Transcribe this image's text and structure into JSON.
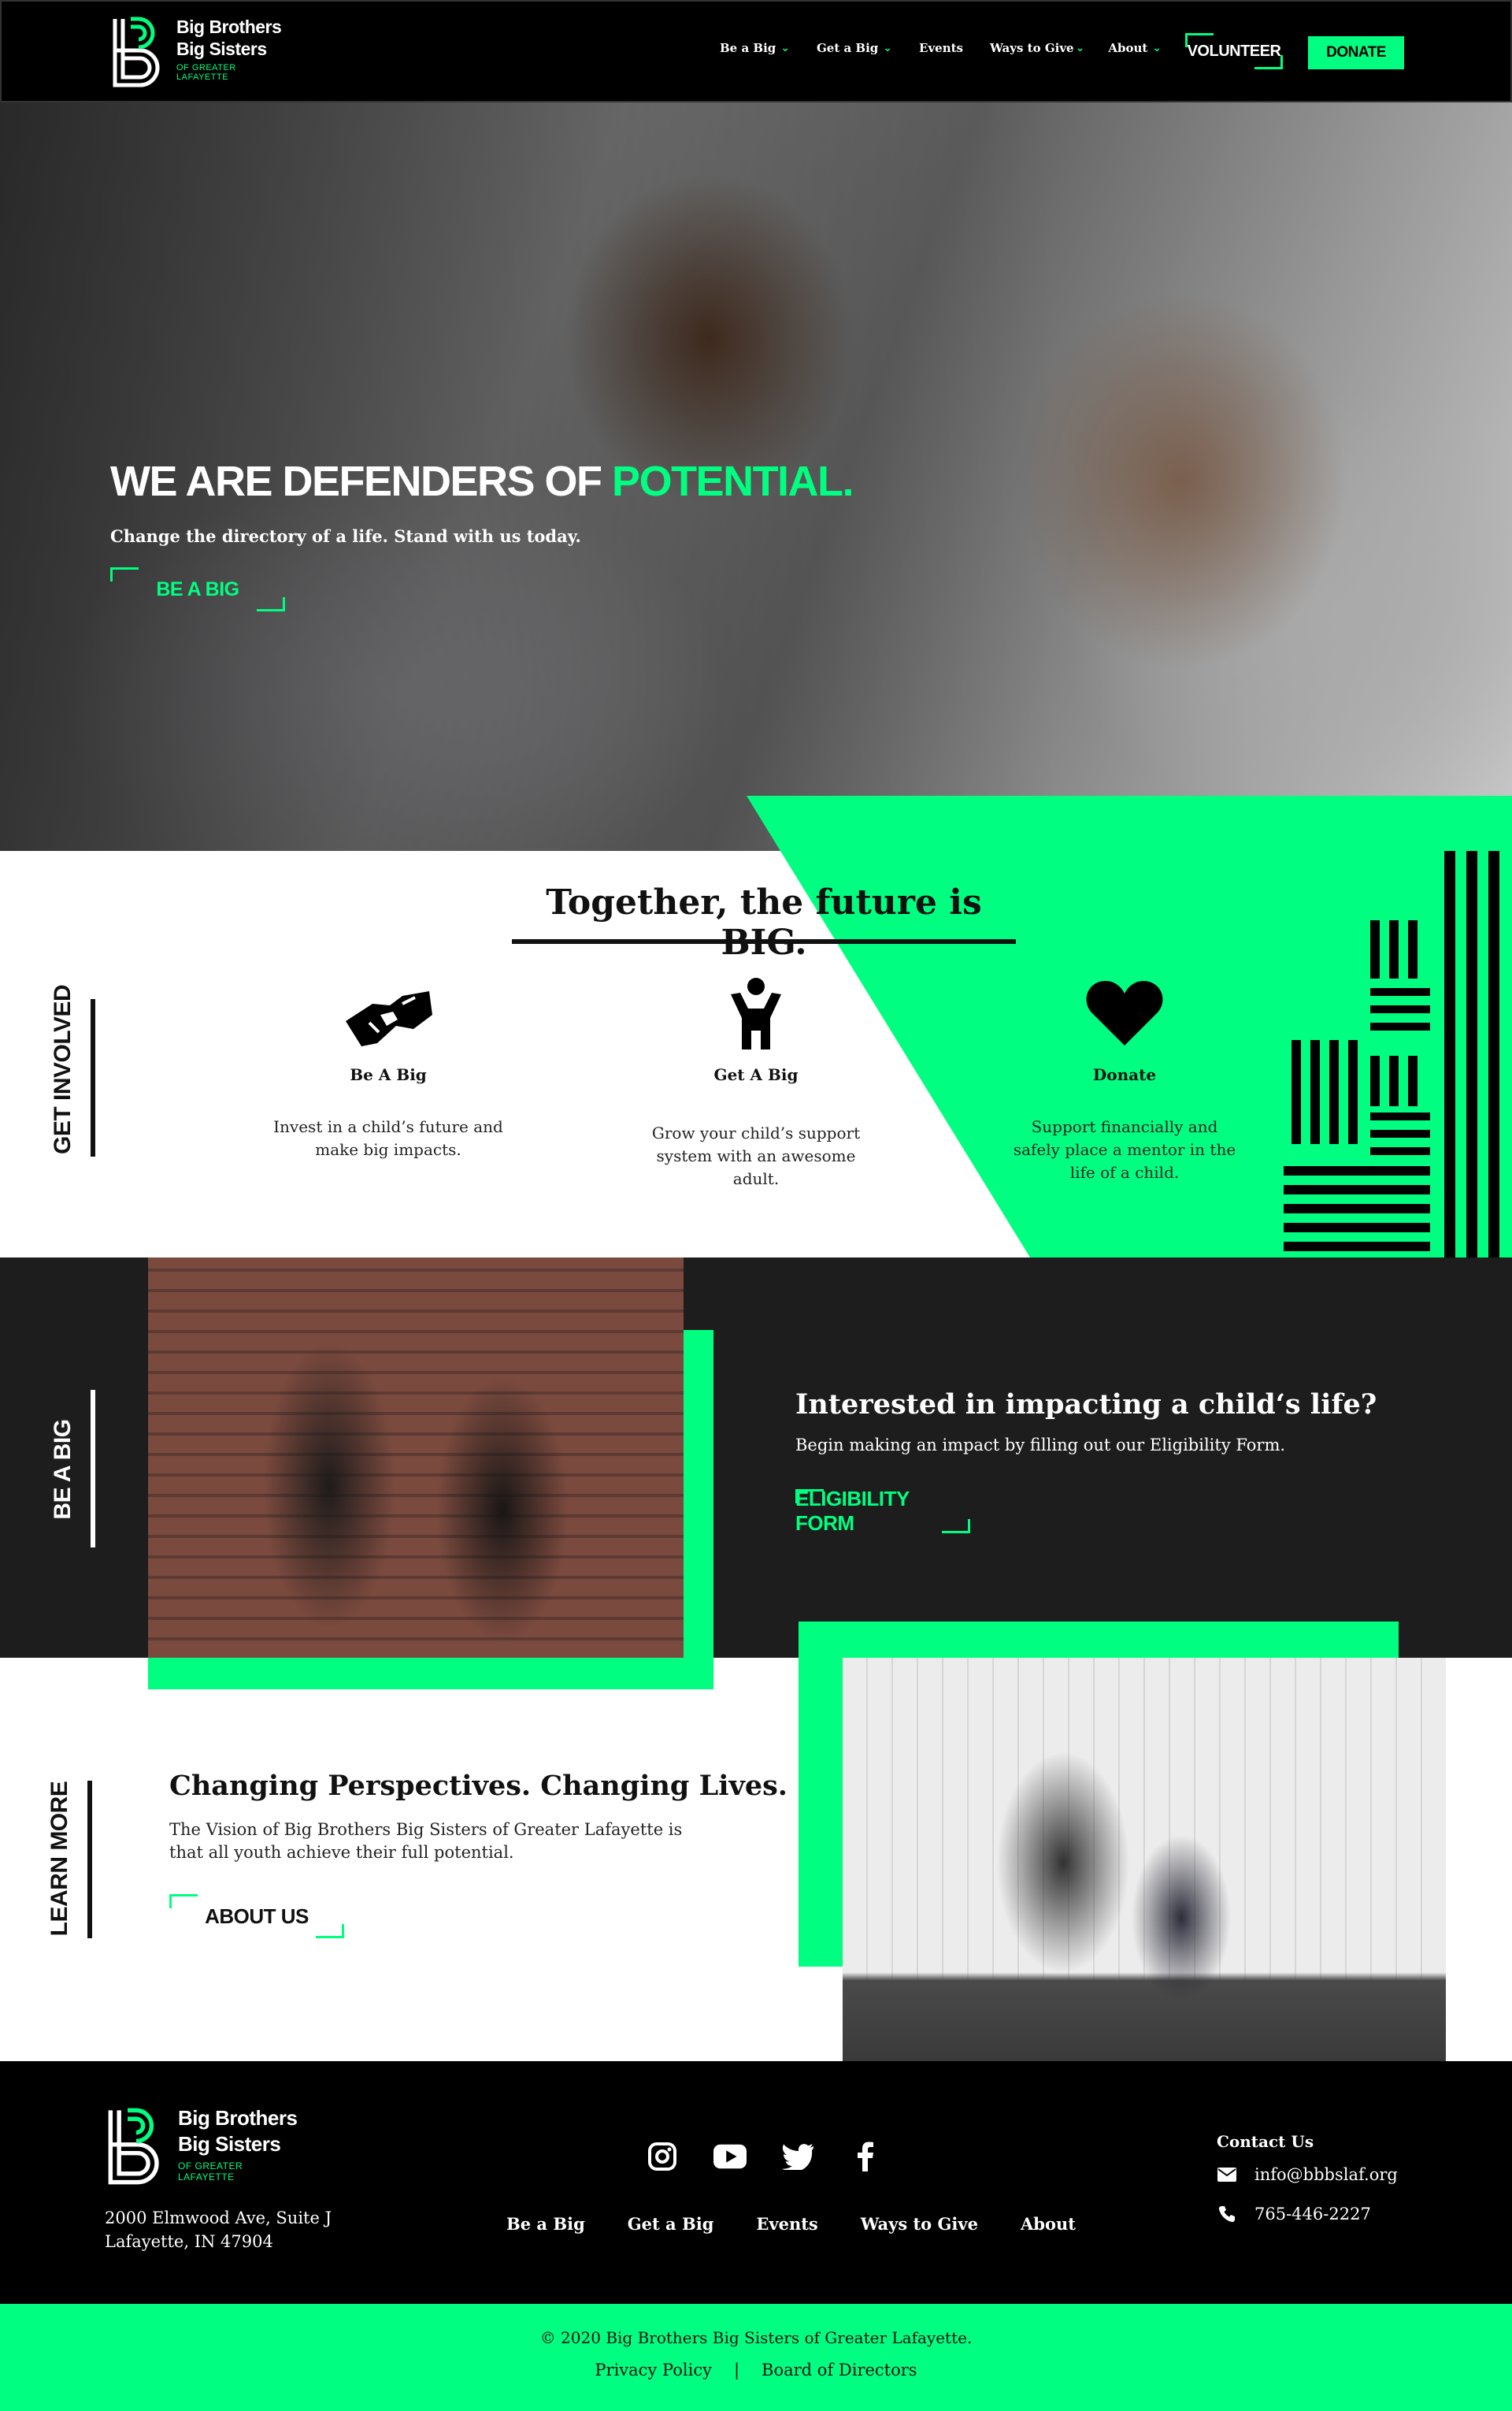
{
  "header": {
    "logo": {
      "line1": "Big Brothers",
      "line2": "Big Sisters",
      "line3": "OF GREATER",
      "line4": "LAFAYETTE"
    },
    "nav": [
      {
        "label": "Be a Big",
        "has_dropdown": true
      },
      {
        "label": "Get a Big",
        "has_dropdown": true
      },
      {
        "label": "Events",
        "has_dropdown": false
      },
      {
        "label": "Ways to Give",
        "has_dropdown": true
      },
      {
        "label": "About",
        "has_dropdown": true
      }
    ],
    "volunteer_label": "VOLUNTEER",
    "donate_label": "DONATE"
  },
  "hero": {
    "title_prefix": "WE ARE DEFENDERS OF ",
    "title_highlight": "POTENTIAL.",
    "subtitle": "Change the directory of a life. Stand with us today.",
    "button": "BE A BIG"
  },
  "together": {
    "title": "Together, the future is BIG.",
    "side_label": "GET INVOLVED",
    "cards": [
      {
        "icon": "handshake-icon",
        "title": "Be A Big",
        "desc": "Invest in a child’s future and make big impacts."
      },
      {
        "icon": "child-icon",
        "title": "Get A Big",
        "desc": "Grow your child’s support system with an awesome adult."
      },
      {
        "icon": "heart-icon",
        "title": "Donate",
        "desc": "Support financially and safely place a mentor in the life of a child."
      }
    ]
  },
  "be_a_big": {
    "side_label": "BE A BIG",
    "title": "Interested in impacting a child‘s life?",
    "desc": "Begin making an impact by filling out our Eligibility Form.",
    "button": "ELIGIBILITY FORM"
  },
  "learn_more": {
    "side_label": "LEARN MORE",
    "title": "Changing Perspectives. Changing Lives.",
    "desc": "The Vision of Big Brothers Big Sisters of Greater Lafayette is that all youth achieve their full potential.",
    "button": "ABOUT US"
  },
  "footer": {
    "address_line1": "2000 Elmwood Ave, Suite J",
    "address_line2": "Lafayette, IN 47904",
    "social": [
      "instagram-icon",
      "youtube-icon",
      "twitter-icon",
      "facebook-icon"
    ],
    "nav": [
      "Be a Big",
      "Get a Big",
      "Events",
      "Ways to Give",
      "About"
    ],
    "contact_title": "Contact Us",
    "email": "info@bbbslaf.org",
    "phone": "765-446-2227",
    "copyright": "© 2020 Big Brothers Big Sisters of Greater Lafayette.",
    "privacy": "Privacy Policy",
    "separator": "|",
    "board": "Board of Directors"
  },
  "colors": {
    "accent": "#00ff80",
    "dark": "#000000",
    "panel": "#1d1d1d"
  }
}
